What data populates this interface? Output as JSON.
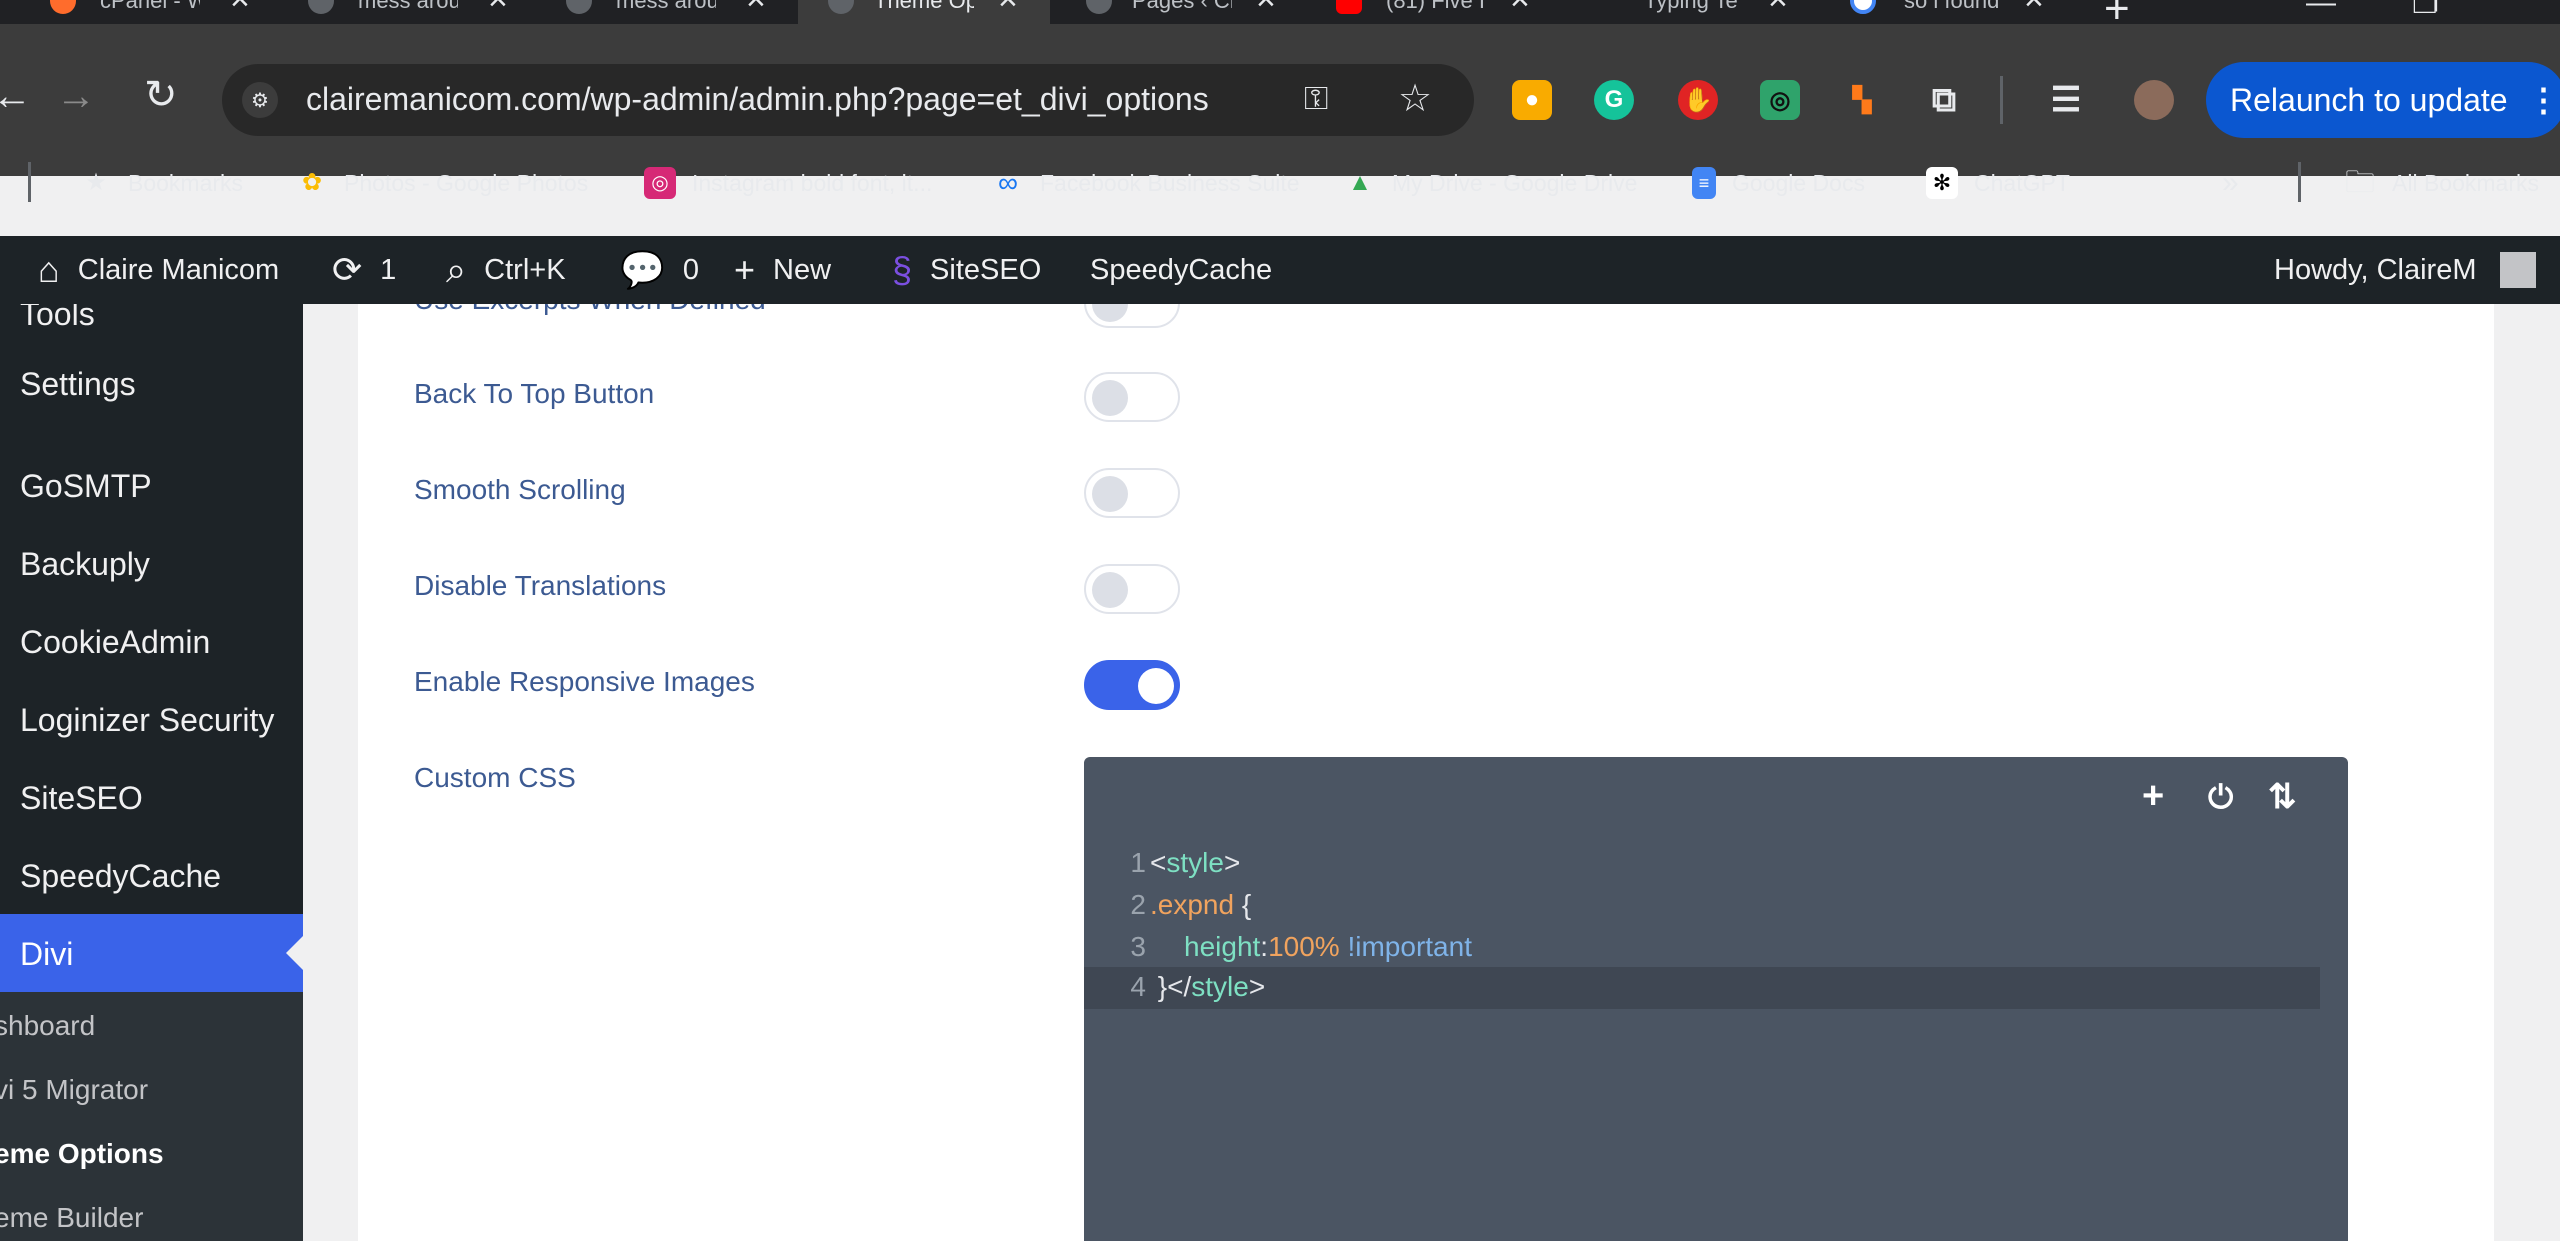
{
  "browser": {
    "tabs": [
      {
        "title": "cPanel - W",
        "active": false
      },
      {
        "title": "mess arou",
        "active": false
      },
      {
        "title": "mess arou",
        "active": false
      },
      {
        "title": "Theme Op",
        "active": true
      },
      {
        "title": "Pages ‹ Cl",
        "active": false
      },
      {
        "title": "(81) Five I",
        "active": false
      },
      {
        "title": "Typing Te",
        "active": false
      },
      {
        "title": "so i found",
        "active": false
      }
    ],
    "url": "clairemanicom.com/wp-admin/admin.php?page=et_divi_options",
    "relaunch_label": "Relaunch to update",
    "bookmarks": [
      {
        "label": "Bookmarks",
        "icon": "star-icon"
      },
      {
        "label": "Photos - Google Photos",
        "icon": "google-photos-icon"
      },
      {
        "label": "Instagram bold font, it...",
        "icon": "instagram-icon"
      },
      {
        "label": "Facebook Business Suite",
        "icon": "meta-icon"
      },
      {
        "label": "My Drive - Google Drive",
        "icon": "google-drive-icon"
      },
      {
        "label": "Google Docs",
        "icon": "google-docs-icon"
      },
      {
        "label": "ChatGPT",
        "icon": "chatgpt-icon"
      }
    ],
    "all_bookmarks": "All Bookmarks"
  },
  "adminbar": {
    "site_name": "Claire Manicom",
    "updates_count": "1",
    "search_shortcut": "Ctrl+K",
    "comments_count": "0",
    "new_label": "New",
    "siteseo_label": "SiteSEO",
    "speedycache_label": "SpeedyCache",
    "howdy": "Howdy, ClaireM"
  },
  "sidebar": {
    "items": [
      "Tools",
      "Settings",
      "GoSMTP",
      "Backuply",
      "CookieAdmin",
      "Loginizer Security",
      "SiteSEO",
      "SpeedyCache"
    ],
    "active": "Divi",
    "submenu": [
      "shboard",
      "vi 5 Migrator",
      "eme Options",
      "eme Builder"
    ]
  },
  "options": {
    "partial_label": "Use Excerpts When Defined",
    "rows": [
      {
        "label": "Back To Top Button",
        "enabled": false
      },
      {
        "label": "Smooth Scrolling",
        "enabled": false
      },
      {
        "label": "Disable Translations",
        "enabled": false
      },
      {
        "label": "Enable Responsive Images",
        "enabled": true
      }
    ],
    "custom_css_label": "Custom CSS"
  },
  "editor": {
    "line_numbers": [
      "1",
      "2",
      "3",
      "4"
    ],
    "code": {
      "l1_open": "<",
      "l1_tag": "style",
      "l1_close": ">",
      "l2_sel": ".expnd",
      "l2_brace": " {",
      "l3_prop": "height",
      "l3_colon": ":",
      "l3_val": "100%",
      "l3_imp": " !important",
      "l4_open": " }</",
      "l4_tag": "style",
      "l4_close": ">"
    }
  }
}
